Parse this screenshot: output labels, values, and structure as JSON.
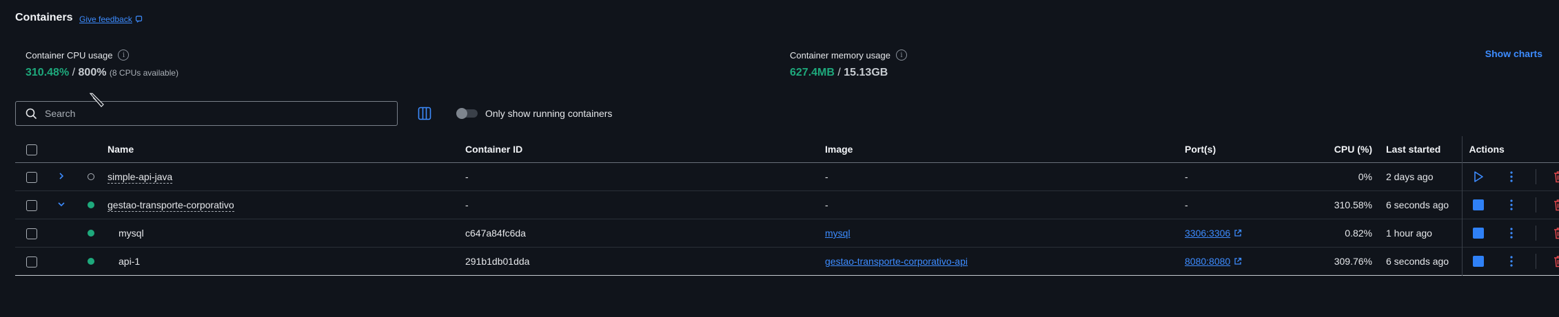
{
  "header": {
    "title": "Containers",
    "feedback": "Give feedback"
  },
  "stats": {
    "cpu": {
      "label": "Container CPU usage",
      "used": "310.48%",
      "separator": "/",
      "total": "800%",
      "note": "(8 CPUs available)"
    },
    "memory": {
      "label": "Container memory usage",
      "used": "627.4MB",
      "separator": "/",
      "total": "15.13GB"
    },
    "show_charts": "Show charts"
  },
  "toolbar": {
    "search_placeholder": "Search",
    "running_toggle_label": "Only show running containers",
    "running_toggle_on": false
  },
  "table": {
    "headers": {
      "name": "Name",
      "id": "Container ID",
      "image": "Image",
      "ports": "Port(s)",
      "cpu": "CPU (%)",
      "started": "Last started",
      "actions": "Actions"
    },
    "rows": [
      {
        "name": "simple-api-java",
        "id": "-",
        "image": "-",
        "ports": "-",
        "cpu": "0%",
        "started": "2 days ago",
        "status": "stopped",
        "expander": "collapsed"
      },
      {
        "name": "gestao-transporte-corporativo",
        "id": "-",
        "image": "-",
        "ports": "-",
        "cpu": "310.58%",
        "started": "6 seconds ago",
        "status": "running",
        "expander": "expanded"
      },
      {
        "name": "mysql",
        "id": "c647a84fc6da",
        "image": "mysql",
        "ports": "3306:3306",
        "cpu": "0.82%",
        "started": "1 hour ago",
        "status": "running",
        "child": true
      },
      {
        "name": "api-1",
        "id": "291b1db01dda",
        "image": "gestao-transporte-corporativo-api",
        "ports": "8080:8080",
        "cpu": "309.76%",
        "started": "6 seconds ago",
        "status": "running",
        "child": true
      }
    ]
  },
  "colors": {
    "accent": "#3d8cff",
    "running": "#1ea97c",
    "delete": "#e5484d",
    "background": "#10141b"
  }
}
